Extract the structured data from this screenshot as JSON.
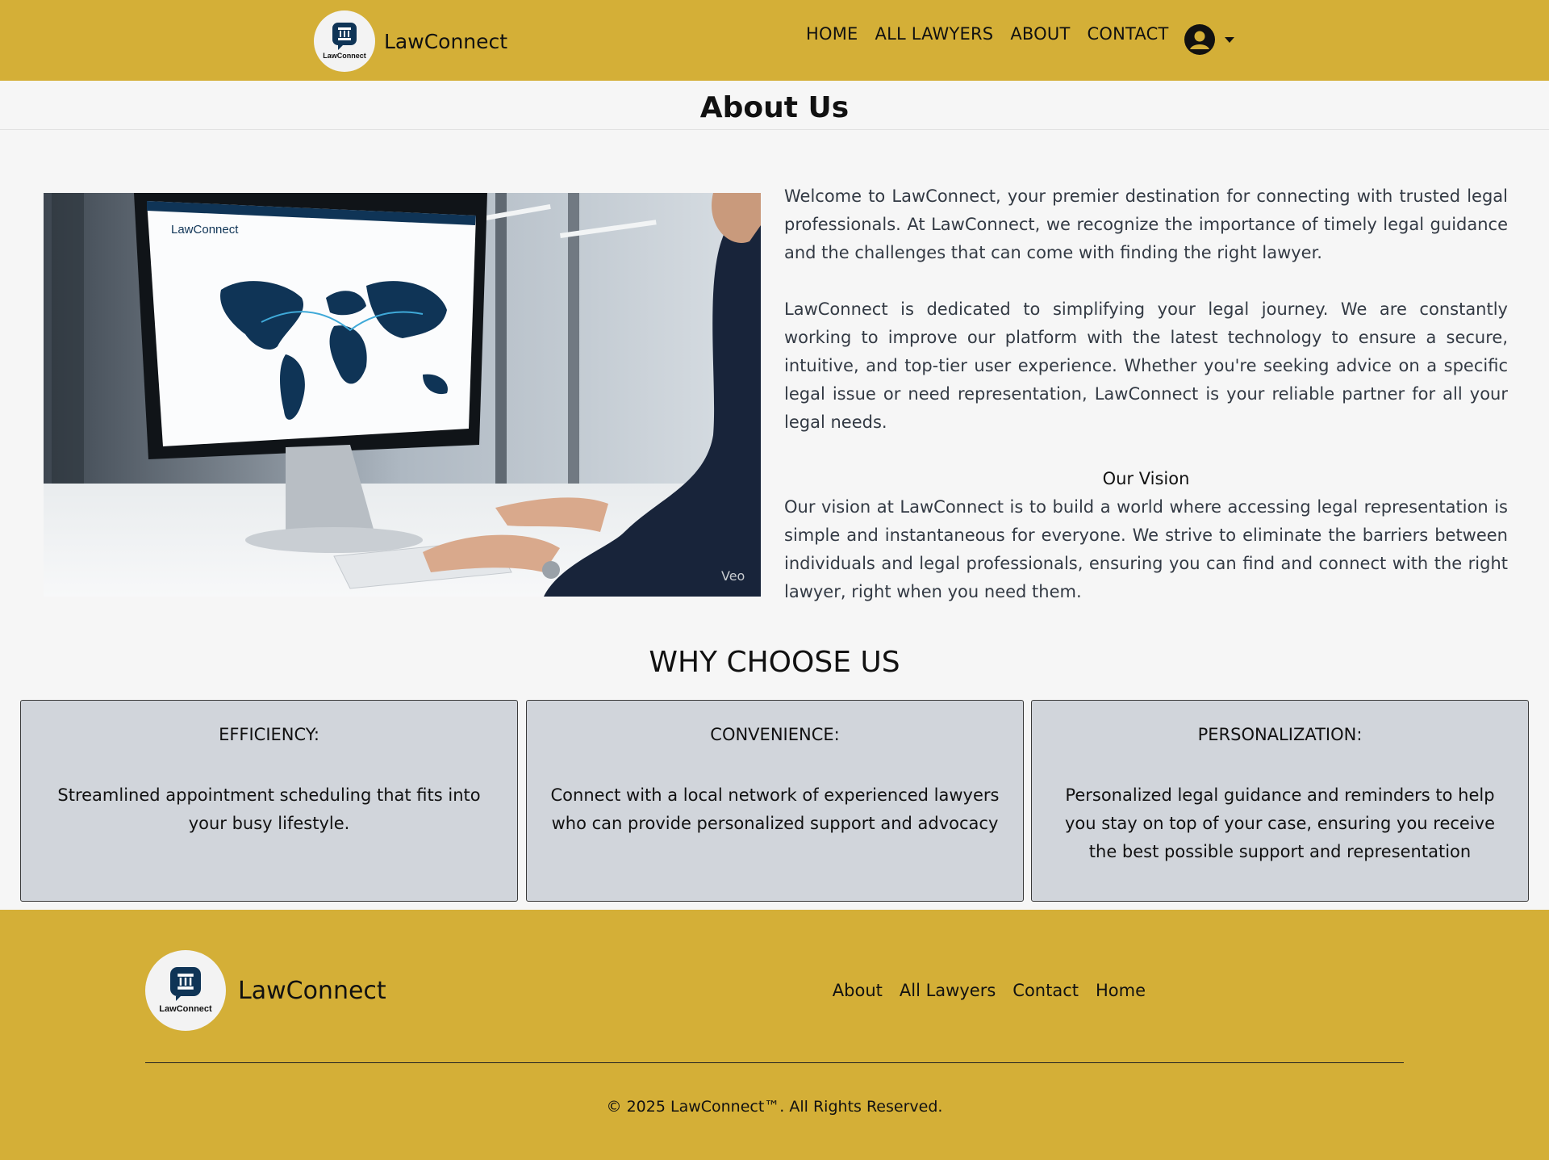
{
  "header": {
    "brand_name": "LawConnect",
    "logo_text": "LawConnect",
    "nav": [
      "HOME",
      "ALL LAWYERS",
      "ABOUT",
      "CONTACT"
    ]
  },
  "page": {
    "title": "About Us"
  },
  "about": {
    "image_watermark": "Veo",
    "screen_brand": "LawConnect",
    "paragraph1": "Welcome to LawConnect, your premier destination for connecting with trusted legal professionals. At LawConnect, we recognize the importance of timely legal guidance and the challenges that can come with finding the right lawyer.",
    "paragraph2": "LawConnect is dedicated to simplifying your legal journey. We are constantly working to improve our platform with the latest technology to ensure a secure, intuitive, and top-tier user experience. Whether you're seeking advice on a specific legal issue or need representation, LawConnect is your reliable partner for all your legal needs.",
    "vision_title": "Our Vision",
    "vision_text": "Our vision at LawConnect is to build a world where accessing legal representation is simple and instantaneous for everyone. We strive to eliminate the barriers between individuals and legal professionals, ensuring you can find and connect with the right lawyer, right when you need them."
  },
  "why": {
    "title": "WHY CHOOSE US",
    "cards": [
      {
        "title": "EFFICIENCY:",
        "body": "Streamlined appointment scheduling that fits into your busy lifestyle."
      },
      {
        "title": "CONVENIENCE:",
        "body": "Connect with a local network of experienced lawyers who can provide personalized support and advocacy"
      },
      {
        "title": "PERSONALIZATION:",
        "body": "Personalized legal guidance and reminders to help you stay on top of your case, ensuring you receive the best possible support and representation"
      }
    ]
  },
  "footer": {
    "brand_name": "LawConnect",
    "logo_text": "LawConnect",
    "links": [
      "About",
      "All Lawyers",
      "Contact",
      "Home"
    ],
    "copyright": "© 2025 LawConnect™. All Rights Reserved."
  },
  "colors": {
    "brand_gold": "#d4af37",
    "card_bg": "#d1d5db",
    "logo_navy": "#0f3456"
  }
}
